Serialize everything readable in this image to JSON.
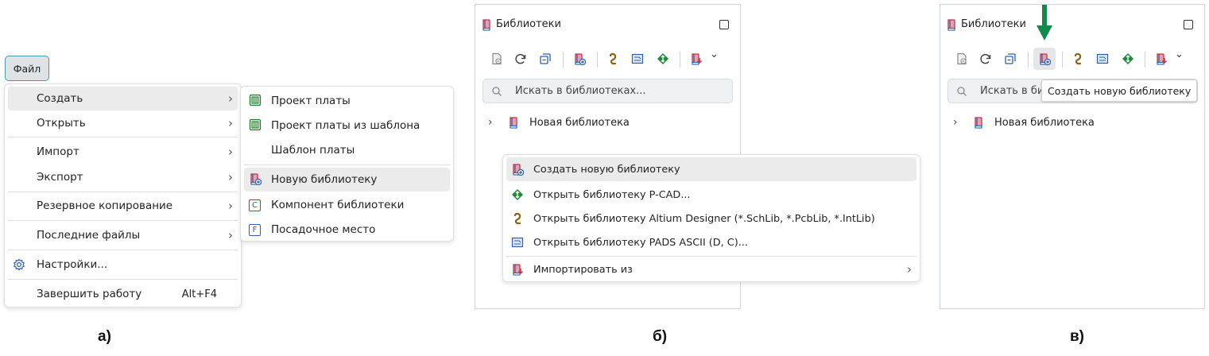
{
  "panel_a": {
    "file_button": "Файл",
    "menu_items": [
      {
        "label": "Создать",
        "arrow": "›"
      },
      {
        "label": "Открыть",
        "arrow": "›"
      },
      {
        "label": "Импорт",
        "arrow": "›"
      },
      {
        "label": "Экспорт",
        "arrow": "›"
      },
      {
        "label": "Резервное копирование",
        "arrow": "›"
      },
      {
        "label": "Последние файлы",
        "arrow": "›"
      },
      {
        "label": "Настройки..."
      },
      {
        "label": "Завершить работу",
        "shortcut": "Alt+F4"
      }
    ],
    "submenu_items": [
      {
        "label": "Проект платы",
        "icon": "board-project-icon"
      },
      {
        "label": "Проект платы из шаблона",
        "icon": "board-template-project-icon"
      },
      {
        "label": "Шаблон платы"
      },
      {
        "label": "Новую библиотеку",
        "icon": "new-library-icon"
      },
      {
        "label": "Компонент библиотеки",
        "icon_letter": "C"
      },
      {
        "label": "Посадочное место",
        "icon_letter": "F"
      }
    ],
    "caption": "а)"
  },
  "panel_b": {
    "title": "Библиотеки",
    "search_placeholder": "Искать в библиотеках...",
    "tree_item": "Новая библиотека",
    "context_menu": [
      {
        "label": "Создать новую библиотеку",
        "icon": "new-library-icon"
      },
      {
        "label": "Открыть библиотеку P-CAD...",
        "icon": "pcad-icon"
      },
      {
        "label": "Открыть библиотеку Altium Designer (*.SchLib, *.PcbLib, *.IntLib)",
        "icon": "altium-icon"
      },
      {
        "label": "Открыть библиотеку PADS ASCII (D, C)...",
        "icon": "pads-icon"
      },
      {
        "label": "Импортировать из",
        "icon": "import-icon",
        "arrow": "›"
      }
    ],
    "caption": "б)"
  },
  "panel_c": {
    "title": "Библиотеки",
    "search_placeholder": "Искать в библиотеках...",
    "search_visible": "Искать в би",
    "tree_item": "Новая библиотека",
    "tooltip": "Создать новую библиотеку",
    "caption": "в)"
  },
  "colors": {
    "accent_teal": "#4a9aa3",
    "library_red": "#c8324a",
    "library_blue": "#2f5fa8",
    "arrow_green": "#14894c",
    "altium_brown": "#8a6414",
    "pcad_green": "#1f8a3a",
    "highlight": "#ebebeb"
  }
}
